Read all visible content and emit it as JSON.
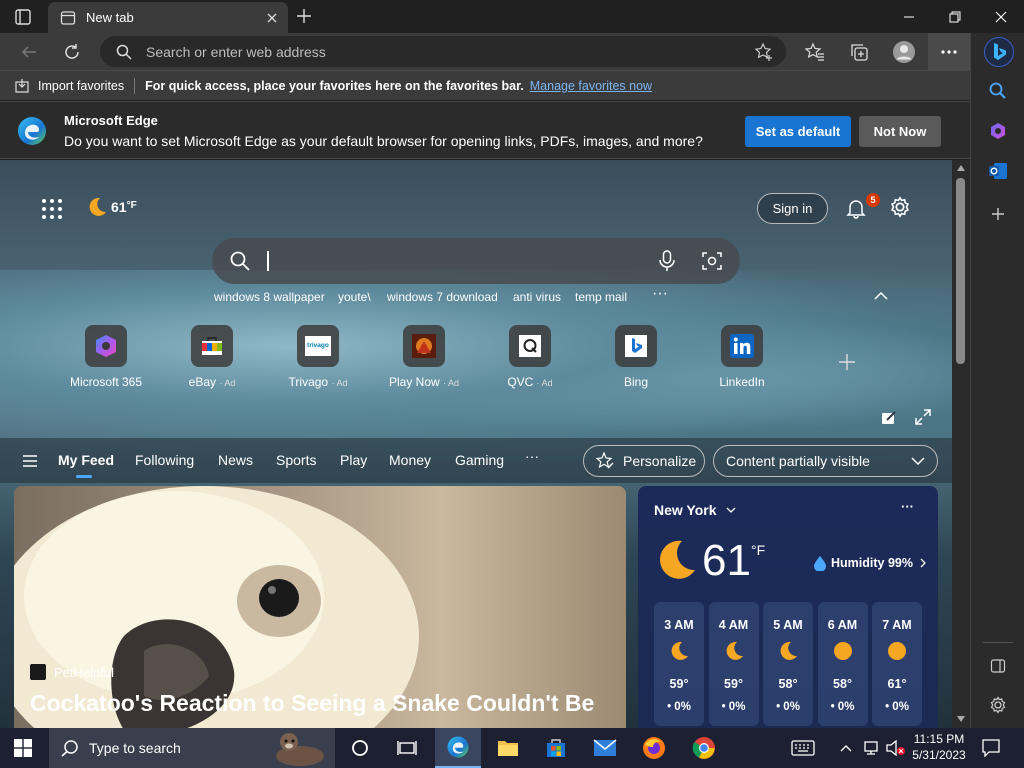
{
  "tab": {
    "title": "New tab"
  },
  "address_bar": {
    "placeholder": "Search or enter web address"
  },
  "favorites_bar": {
    "import_label": "Import favorites",
    "message": "For quick access, place your favorites here on the favorites bar.",
    "link": "Manage favorites now"
  },
  "infobar": {
    "title": "Microsoft Edge",
    "message": "Do you want to set Microsoft Edge as your default browser for opening links, PDFs, images, and more?",
    "primary_button": "Set as default",
    "secondary_button": "Not Now"
  },
  "newtab": {
    "temperature": "61",
    "temp_unit": "°F",
    "sign_in": "Sign in",
    "notification_count": "5",
    "suggestions": [
      "windows 8 wallpaper",
      "youte\\",
      "windows 7 download",
      "anti virus",
      "temp mail"
    ],
    "quick_links": [
      {
        "label": "Microsoft 365",
        "ad": ""
      },
      {
        "label": "eBay",
        "ad": "· Ad"
      },
      {
        "label": "Trivago",
        "ad": "· Ad"
      },
      {
        "label": "Play Now",
        "ad": "· Ad"
      },
      {
        "label": "QVC",
        "ad": "· Ad"
      },
      {
        "label": "Bing",
        "ad": ""
      },
      {
        "label": "LinkedIn",
        "ad": ""
      }
    ],
    "trivago_logo_text": "trivago"
  },
  "feed_nav": {
    "items": [
      "My Feed",
      "Following",
      "News",
      "Sports",
      "Play",
      "Money",
      "Gaming"
    ],
    "more": "···",
    "personalize": "Personalize",
    "visibility": "Content partially visible"
  },
  "hero": {
    "source": "PetHelpful",
    "headline": "Cockatoo's Reaction to Seeing a Snake Couldn't Be"
  },
  "weather": {
    "city": "New York",
    "temp": "61",
    "unit": "°F",
    "humidity": "Humidity 99%",
    "hours": [
      {
        "time": "3 AM",
        "temp": "59°",
        "precip": "0%",
        "icon": "moon"
      },
      {
        "time": "4 AM",
        "temp": "59°",
        "precip": "0%",
        "icon": "moon"
      },
      {
        "time": "5 AM",
        "temp": "58°",
        "precip": "0%",
        "icon": "moon"
      },
      {
        "time": "6 AM",
        "temp": "58°",
        "precip": "0%",
        "icon": "sun"
      },
      {
        "time": "7 AM",
        "temp": "61°",
        "precip": "0%",
        "icon": "sun"
      }
    ]
  },
  "taskbar": {
    "search_placeholder": "Type to search",
    "time": "11:15 PM",
    "date": "5/31/2023"
  },
  "colors": {
    "accent": "#1a74d2",
    "link": "#7cb4f0",
    "weather_bg": "#1a2a52"
  }
}
